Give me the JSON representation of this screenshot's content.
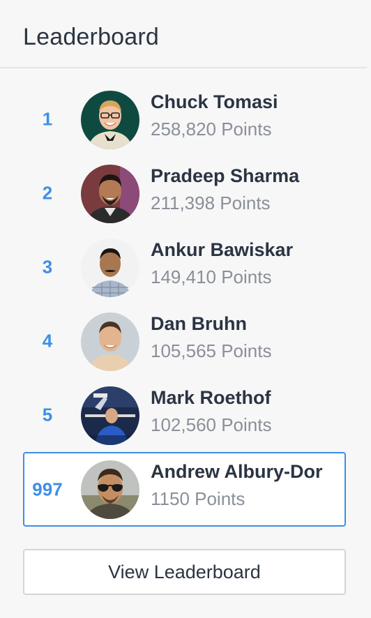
{
  "leaderboard": {
    "title": "Leaderboard",
    "entries": [
      {
        "rank": "1",
        "name": "Chuck Tomasi",
        "points": "258,820 Points"
      },
      {
        "rank": "2",
        "name": "Pradeep Sharma",
        "points": "211,398 Points"
      },
      {
        "rank": "3",
        "name": "Ankur Bawiskar",
        "points": "149,410 Points"
      },
      {
        "rank": "4",
        "name": "Dan Bruhn",
        "points": "105,565 Points"
      },
      {
        "rank": "5",
        "name": "Mark Roethof",
        "points": "102,560 Points"
      }
    ],
    "current_user": {
      "rank": "997",
      "name": "Andrew Albury-Dor",
      "points": "1150 Points"
    },
    "view_button_label": "View Leaderboard"
  },
  "colors": {
    "accent": "#3d8fe6",
    "text": "#2b3442",
    "muted": "#8a8f98",
    "background": "#f7f7f8"
  }
}
